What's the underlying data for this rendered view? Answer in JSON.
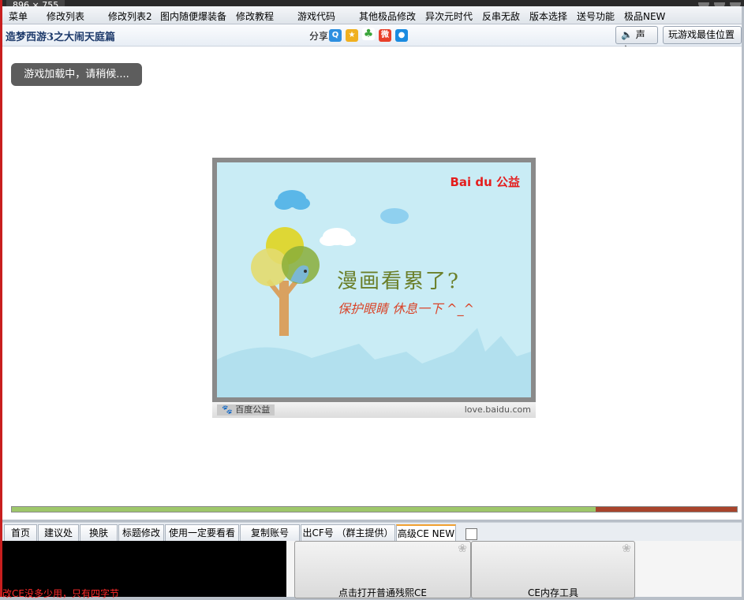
{
  "window": {
    "size_label": "896 × 755"
  },
  "menu": {
    "items": [
      "菜单",
      "修改列表",
      "修改列表2",
      "图内随便爆装备",
      "修改教程",
      "游戏代码",
      "其他极品修改",
      "异次元时代",
      "反串无敌",
      "版本选择",
      "送号功能",
      "极品NEW"
    ]
  },
  "header": {
    "title": "造梦西游3之大闹天庭篇",
    "share_label": "分享到：",
    "share_icons": [
      "qzone-icon",
      "qq-weibo-icon",
      "clover-icon",
      "sina-weibo-icon",
      "qq-icon"
    ],
    "sound_label": "声音",
    "best_position_label": "玩游戏最佳位置"
  },
  "game": {
    "loading_text": "游戏加载中，请稍候....",
    "ad": {
      "logo": "Bai du 公益",
      "headline": "漫画看累了?",
      "subline": "保护眼睛 休息一下 ^_^",
      "footer_left": "百度公益",
      "footer_right": "love.baidu.com"
    },
    "progress": 0.805
  },
  "tabs": [
    "首页",
    "建议处",
    "换肤",
    "标题修改",
    "使用一定要看看",
    "复制账号NEW",
    "出CF号 （群主提供）",
    "高级CE NEW"
  ],
  "active_tab": "高级CE NEW",
  "bottom": {
    "red_message": "改CE没多少用，只有四字节",
    "button1": "点击打开普通残熙CE",
    "button2": "CE内存工具"
  },
  "colors": {
    "accent_red": "#c81e1e",
    "progress_fill": "#9ec76a",
    "progress_track": "#a8442c"
  }
}
